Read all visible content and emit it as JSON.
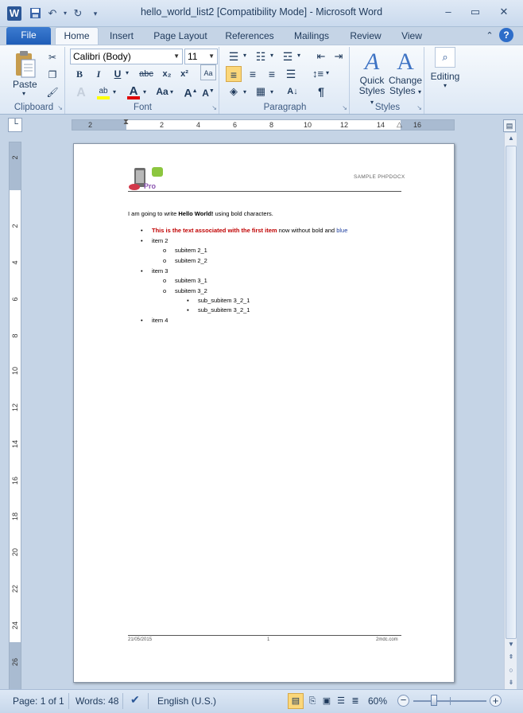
{
  "titlebar": {
    "app_icon": "W",
    "title": "hello_world_list2 [Compatibility Mode]  -  Microsoft Word",
    "qat_icons": [
      "save-icon",
      "undo-icon",
      "redo-icon",
      "customize-icon"
    ]
  },
  "tabs": [
    {
      "label": "File"
    },
    {
      "label": "Home"
    },
    {
      "label": "Insert"
    },
    {
      "label": "Page Layout"
    },
    {
      "label": "References"
    },
    {
      "label": "Mailings"
    },
    {
      "label": "Review"
    },
    {
      "label": "View"
    }
  ],
  "ribbon": {
    "clipboard": {
      "label": "Clipboard",
      "paste": "Paste"
    },
    "font": {
      "label": "Font",
      "font_name": "Calibri (Body)",
      "font_size": "11"
    },
    "paragraph": {
      "label": "Paragraph"
    },
    "styles": {
      "label": "Styles",
      "quick_styles_1": "Quick",
      "quick_styles_2": "Styles",
      "change_styles_1": "Change",
      "change_styles_2": "Styles"
    },
    "editing": {
      "label": "Editing"
    }
  },
  "ruler": {
    "h_ticks": [
      "2",
      "2",
      "4",
      "6",
      "8",
      "10",
      "12",
      "14",
      "16"
    ],
    "v_ticks": [
      "2",
      "2",
      "4",
      "6",
      "8",
      "10",
      "12",
      "14",
      "16",
      "18",
      "20",
      "22",
      "24",
      "26"
    ]
  },
  "document": {
    "header_text": "SAMPLE PHPDOCX",
    "intro_pre": "I am going to write ",
    "intro_bold": "Hello World!",
    "intro_post": " using bold characters.",
    "item1_red": "This is the text associated with the first item",
    "item1_plain": " now without bold and ",
    "item1_blue": "blue",
    "item2": "item 2",
    "sub2_1": "subitem 2_1",
    "sub2_2": "subitem 2_2",
    "item3": "item 3",
    "sub3_1": "subitem 3_1",
    "sub3_2": "subitem 3_2",
    "subsub1": "sub_subitem 3_2_1",
    "subsub2": "sub_subitem 3_2_1",
    "item4": "item 4",
    "footer_date": "21/05/2015",
    "footer_page": "1",
    "footer_site": "2mdc.com"
  },
  "status": {
    "page": "Page: 1 of 1",
    "words": "Words: 48",
    "language": "English (U.S.)",
    "zoom": "60%"
  },
  "colors": {
    "red": "#c00000",
    "blue": "#1f3f9f",
    "accent": "#2b5797"
  }
}
